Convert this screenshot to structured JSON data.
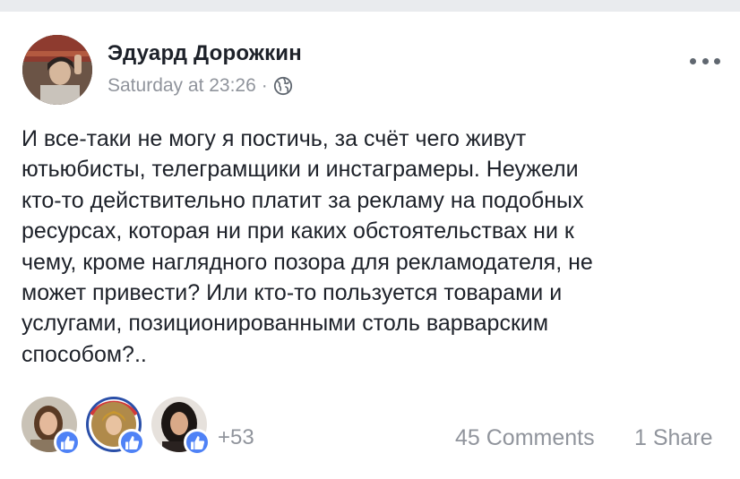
{
  "post": {
    "author": "Эдуард Дорожкин",
    "timestamp": "Saturday at 23:26",
    "separator": "·",
    "privacy_icon": "globe-icon",
    "menu_icon": "more-icon",
    "text": "И все-таки не могу я постичь, за счёт чего живут\nютьюбисты, телеграмщики и инстаграмеры. Неужели\nкто-то действительно платит за рекламу на подобных\nресурсах, которая ни при каких обстоятельствах ни к\nчему, кроме наглядного позора для рекламодателя, не\nможет привести? Или кто-то пользуется товарами и\nуслугами, позиционированными столь варварским\nспособом?.."
  },
  "reactions": {
    "icon": "like-icon",
    "others_count": "+53"
  },
  "footer": {
    "comments": "45 Comments",
    "shares": "1 Share"
  },
  "colors": {
    "background": "#e9ebee",
    "card": "#ffffff",
    "text": "#1d2129",
    "secondary": "#90949c",
    "like_blue": "#4f82f6"
  }
}
